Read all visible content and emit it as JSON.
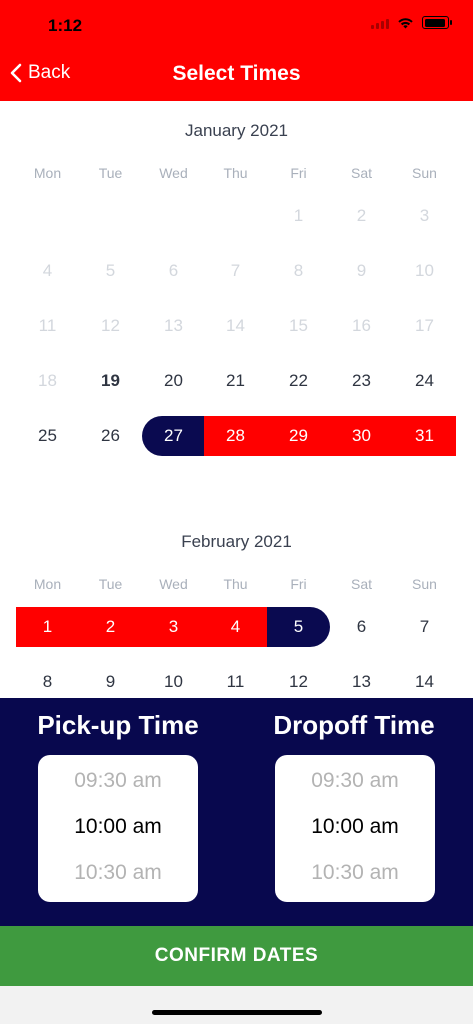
{
  "status_bar": {
    "time": "1:12"
  },
  "header": {
    "back_label": "Back",
    "title": "Select Times"
  },
  "weekdays": [
    "Mon",
    "Tue",
    "Wed",
    "Thu",
    "Fri",
    "Sat",
    "Sun"
  ],
  "months": [
    {
      "title": "January 2021",
      "first_weekday_index": 4,
      "days_shown": 31,
      "past_through": 18,
      "today": 19,
      "range_start": 27,
      "range_end": null,
      "range_middle": [
        28,
        29,
        30,
        31
      ]
    },
    {
      "title": "February 2021",
      "first_weekday_index": 0,
      "days_shown": 14,
      "past_through": 0,
      "today": null,
      "range_start": null,
      "range_end": 5,
      "range_middle": [
        1,
        2,
        3,
        4
      ]
    }
  ],
  "pickup": {
    "label": "Pick-up Time",
    "options": [
      "09:30 am",
      "10:00 am",
      "10:30 am"
    ],
    "selected": "10:00 am"
  },
  "dropoff": {
    "label": "Dropoff Time",
    "options": [
      "09:30 am",
      "10:00 am",
      "10:30 am"
    ],
    "selected": "10:00 am"
  },
  "confirm_label": "CONFIRM DATES",
  "colors": {
    "header": "#ff0000",
    "range": "#ff0000",
    "range_end": "#0a0a50",
    "panel": "#08084e",
    "confirm": "#3f9a3f"
  }
}
